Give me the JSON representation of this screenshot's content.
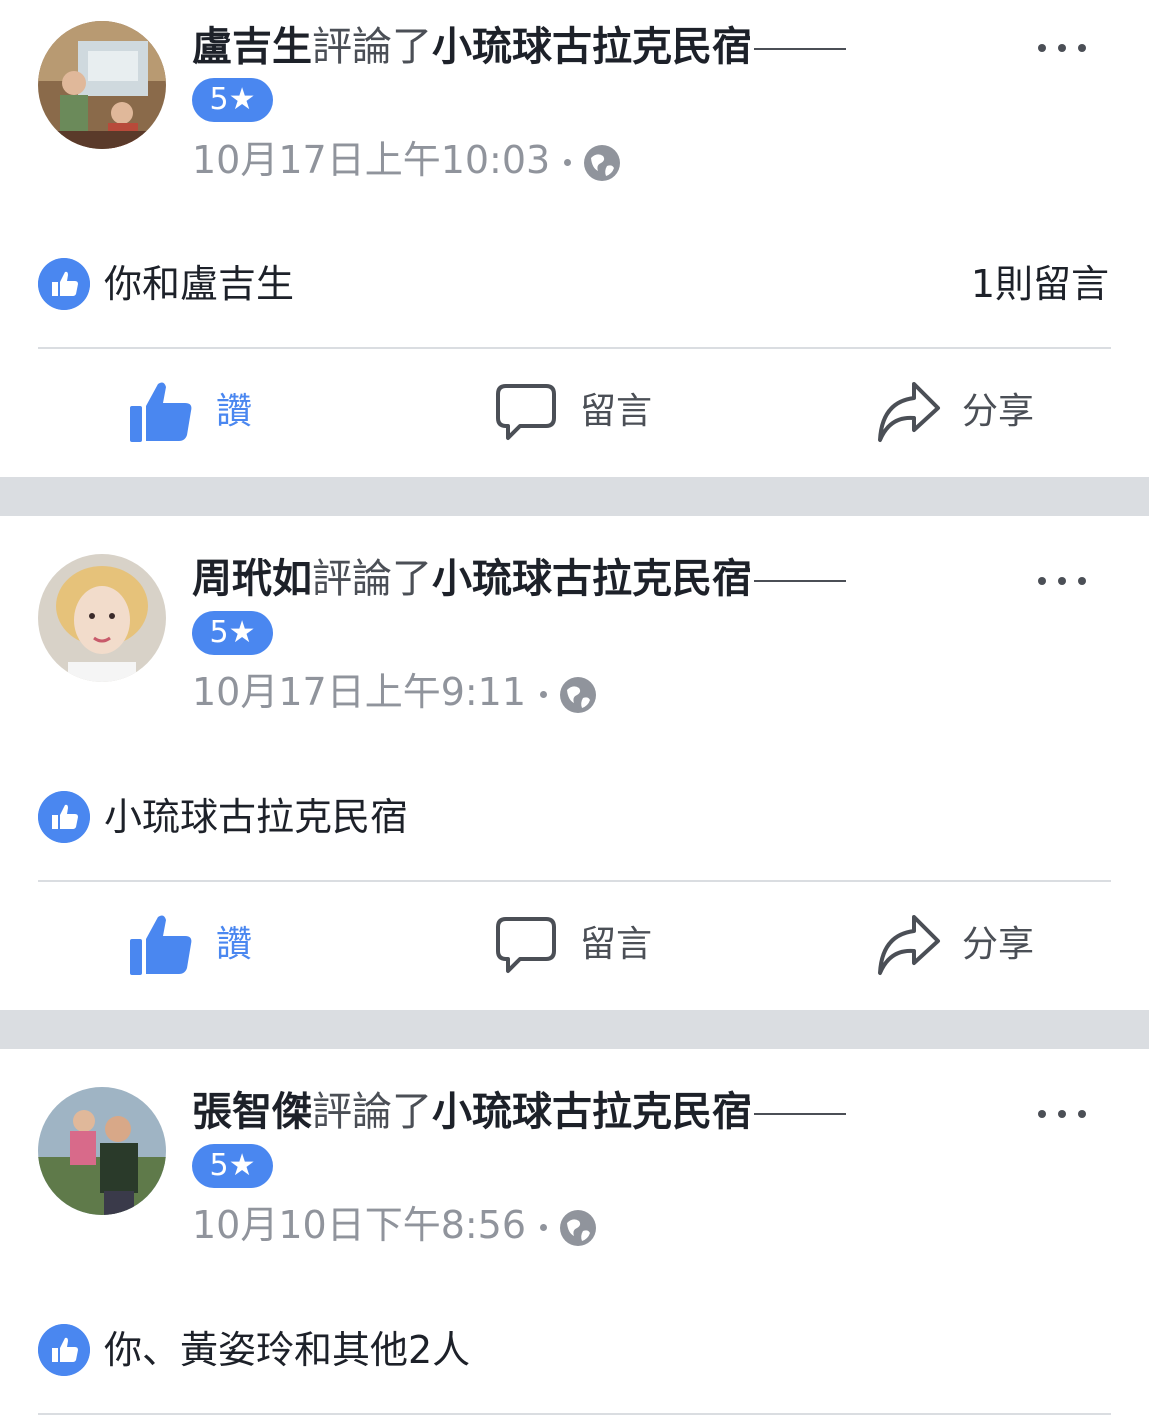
{
  "posts": [
    {
      "author": "盧吉生",
      "verb": "評論了",
      "page": "小琉球古拉克民宿",
      "rating": "5★",
      "timestamp": "10月17日上午10:03",
      "likes_text": "你和盧吉生",
      "comment_count": "1則留言"
    },
    {
      "author": "周玳如",
      "verb": "評論了",
      "page": "小琉球古拉克民宿",
      "rating": "5★",
      "timestamp": "10月17日上午9:11",
      "likes_text": "小琉球古拉克民宿",
      "comment_count": ""
    },
    {
      "author": "張智傑",
      "verb": "評論了",
      "page": "小琉球古拉克民宿",
      "rating": "5★",
      "timestamp": "10月10日下午8:56",
      "likes_text": "你、黃姿玲和其他2人",
      "comment_count": ""
    }
  ],
  "actions": {
    "like_label": "讚",
    "comment_label": "留言",
    "share_label": "分享"
  },
  "colors": {
    "accent": "#4a87f0",
    "text": "#1d2129",
    "secondary": "#90949c",
    "separator": "#dadde1"
  },
  "icons": [
    "globe-icon",
    "like-badge-icon",
    "thumbs-up-icon",
    "comment-bubble-icon",
    "share-arrow-icon",
    "more-options-icon"
  ]
}
